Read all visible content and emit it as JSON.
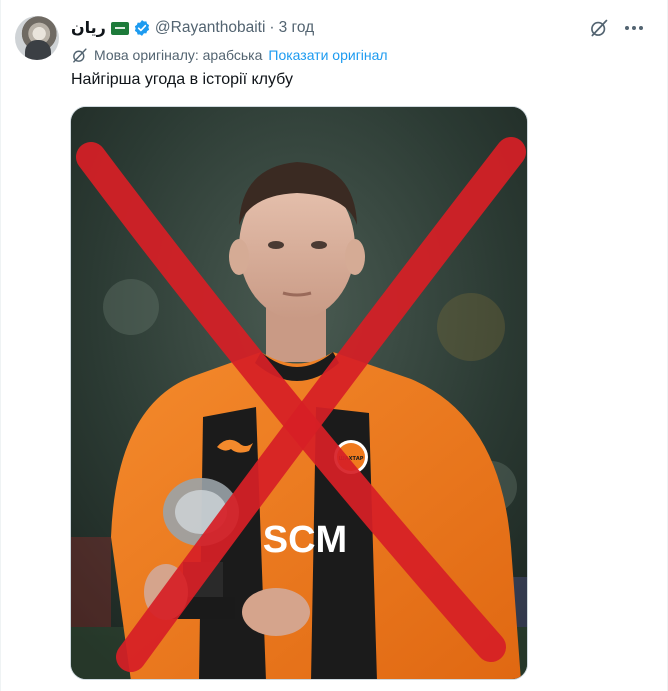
{
  "tweet": {
    "author": {
      "display_name": "ريان",
      "flag_icon": "saudi-flag-icon",
      "verified_icon": "verified-badge-icon",
      "handle": "@Rayanthobaiti",
      "separator": "·",
      "time": "3 год"
    },
    "translation": {
      "icon": "translate-icon",
      "original_language": "Мова оригіналу: арабська",
      "show_original_label": "Показати оригінал"
    },
    "text": "Найгірша угода в історії клубу",
    "top_icons": [
      "grok-icon",
      "more-icon"
    ],
    "media": {
      "shirt_sponsor": "SCM",
      "crest_text": "ШАХТАР",
      "colors": {
        "shirt": "#f07a1e",
        "stripe": "#1b1b1b",
        "cross": "#d61f26"
      }
    }
  },
  "colors": {
    "accent": "#1d9bf0",
    "secondary_text": "#536471",
    "verified": "#1d9bf0"
  }
}
